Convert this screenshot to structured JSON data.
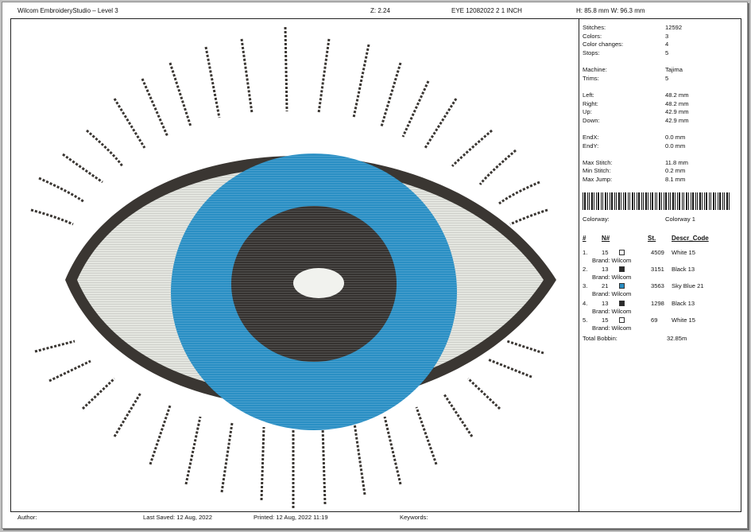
{
  "header": {
    "app_title": "Wilcom EmbroideryStudio – Level 3",
    "zoom": "Z: 2.24",
    "design_name": "EYE 12082022  2 1 INCH",
    "size": "H: 85.8 mm   W: 96.3 mm"
  },
  "stats": {
    "stitches_label": "Stitches:",
    "stitches": "12592",
    "colors_label": "Colors:",
    "colors": "3",
    "color_changes_label": "Color changes:",
    "color_changes": "4",
    "stops_label": "Stops:",
    "stops": "5",
    "machine_label": "Machine:",
    "machine": "Tajima",
    "trims_label": "Trims:",
    "trims": "5",
    "left_label": "Left:",
    "left": "48.2 mm",
    "right_label": "Right:",
    "right": "48.2 mm",
    "up_label": "Up:",
    "up": "42.9 mm",
    "down_label": "Down:",
    "down": "42.9 mm",
    "endx_label": "EndX:",
    "endx": "0.0 mm",
    "endy_label": "EndY:",
    "endy": "0.0 mm",
    "max_stitch_label": "Max Stitch:",
    "max_stitch": "11.8 mm",
    "min_stitch_label": "Min Stitch:",
    "min_stitch": "0.2 mm",
    "max_jump_label": "Max Jump:",
    "max_jump": "8.1 mm",
    "colorway_label": "Colorway:",
    "colorway": "Colorway 1"
  },
  "colorway_table": {
    "headers": {
      "num": "#",
      "n": "N#",
      "st": "St.",
      "desc": "Descr_Code"
    },
    "rows": [
      {
        "idx": "1.",
        "n": "15",
        "st": "4509",
        "desc": "White 15",
        "brand": "Brand: Wilcom",
        "color": "#ffffff"
      },
      {
        "idx": "2.",
        "n": "13",
        "st": "3151",
        "desc": "Black 13",
        "brand": "Brand: Wilcom",
        "color": "#2b2b2b"
      },
      {
        "idx": "3.",
        "n": "21",
        "st": "3563",
        "desc": "Sky Blue 21",
        "brand": "Brand: Wilcom",
        "color": "#2a8fc4"
      },
      {
        "idx": "4.",
        "n": "13",
        "st": "1298",
        "desc": "Black 13",
        "brand": "Brand: Wilcom",
        "color": "#2b2b2b"
      },
      {
        "idx": "5.",
        "n": "15",
        "st": "69",
        "desc": "White 15",
        "brand": "Brand: Wilcom",
        "color": "#ffffff"
      }
    ],
    "total_label": "Total Bobbin:",
    "total": "32.85m"
  },
  "footer": {
    "author": "Author:",
    "last_saved": "Last Saved:  12 Aug, 2022",
    "printed": "Printed:  12 Aug, 2022 11:19",
    "keywords": "Keywords:"
  },
  "design_colors": {
    "outline": "#3a3632",
    "sclera": "#e4e6e0",
    "iris": "#2a8fc4",
    "pupil": "#353230",
    "highlight": "#f1f2ee"
  }
}
